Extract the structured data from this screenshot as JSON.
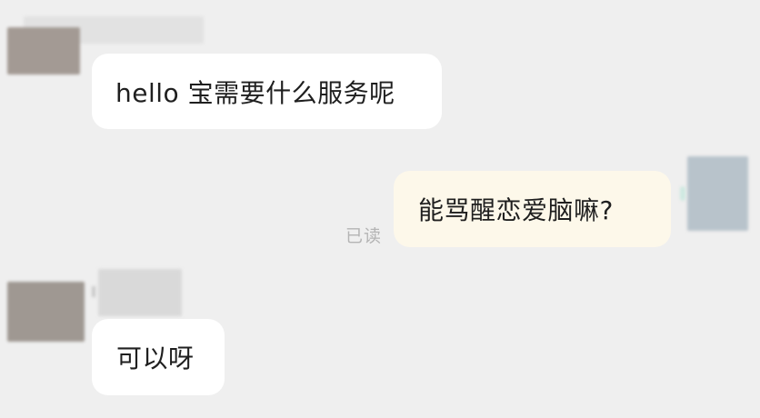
{
  "messages": [
    {
      "side": "incoming",
      "text": "hello 宝需要什么服务呢"
    },
    {
      "side": "outgoing",
      "text": "能骂醒恋爱脑嘛?",
      "status": "已读"
    },
    {
      "side": "incoming",
      "text": "可以呀"
    }
  ]
}
